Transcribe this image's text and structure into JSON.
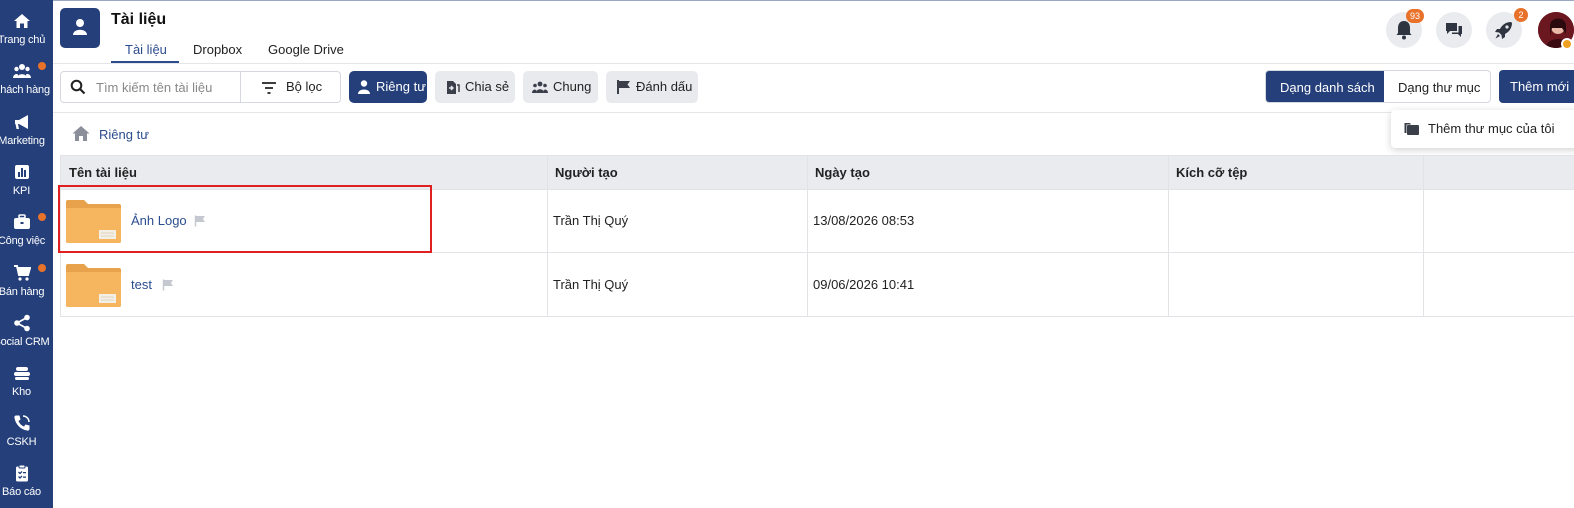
{
  "sidebar": {
    "items": [
      {
        "label": "Trang chủ",
        "icon": "home-icon",
        "dot": false
      },
      {
        "label": "Khách hàng",
        "icon": "users-icon",
        "dot": true
      },
      {
        "label": "Marketing",
        "icon": "megaphone-icon",
        "dot": false
      },
      {
        "label": "KPI",
        "icon": "chart-icon",
        "dot": false
      },
      {
        "label": "Công việc",
        "icon": "briefcase-icon",
        "dot": true
      },
      {
        "label": "Bán hàng",
        "icon": "cart-icon",
        "dot": true
      },
      {
        "label": "Social CRM",
        "icon": "share-icon",
        "dot": false
      },
      {
        "label": "Kho",
        "icon": "warehouse-icon",
        "dot": false
      },
      {
        "label": "CSKH",
        "icon": "phone-icon",
        "dot": false
      },
      {
        "label": "Báo cáo",
        "icon": "clipboard-icon",
        "dot": false
      }
    ]
  },
  "header": {
    "title": "Tài liệu",
    "tabs": [
      {
        "label": "Tài liệu",
        "active": true
      },
      {
        "label": "Dropbox",
        "active": false
      },
      {
        "label": "Google Drive",
        "active": false
      }
    ],
    "notifications_count": "93",
    "rocket_count": "2"
  },
  "toolbar": {
    "search_placeholder": "Tìm kiếm tên tài liệu",
    "filter_label": "Bộ lọc",
    "scopes": [
      {
        "label": "Riêng tư",
        "icon": "user-icon",
        "active": true
      },
      {
        "label": "Chia sẻ",
        "icon": "share-doc-icon",
        "active": false
      },
      {
        "label": "Chung",
        "icon": "group-icon",
        "active": false
      },
      {
        "label": "Đánh dấu",
        "icon": "flag-icon",
        "active": false
      }
    ],
    "view_list_label": "Dạng danh sách",
    "view_folder_label": "Dạng thư mục",
    "add_label": "Thêm mới",
    "dropdown_item": "Thêm thư mục của tôi"
  },
  "breadcrumb": {
    "label": "Riêng tư"
  },
  "table": {
    "columns": [
      "Tên tài liệu",
      "Người tạo",
      "Ngày tạo",
      "Kích cỡ tệp"
    ],
    "rows": [
      {
        "name": "Ảnh Logo",
        "creator": "Trần Thị Quý",
        "created": "13/08/2026 08:53",
        "size": ""
      },
      {
        "name": "test",
        "creator": "Trần Thị Quý",
        "created": "09/06/2026 10:41",
        "size": ""
      }
    ]
  },
  "colors": {
    "primary": "#243f7a",
    "link": "#2b4d8f",
    "badge": "#e8722a",
    "folder": "#f6b55f",
    "highlight": "#e02020"
  }
}
